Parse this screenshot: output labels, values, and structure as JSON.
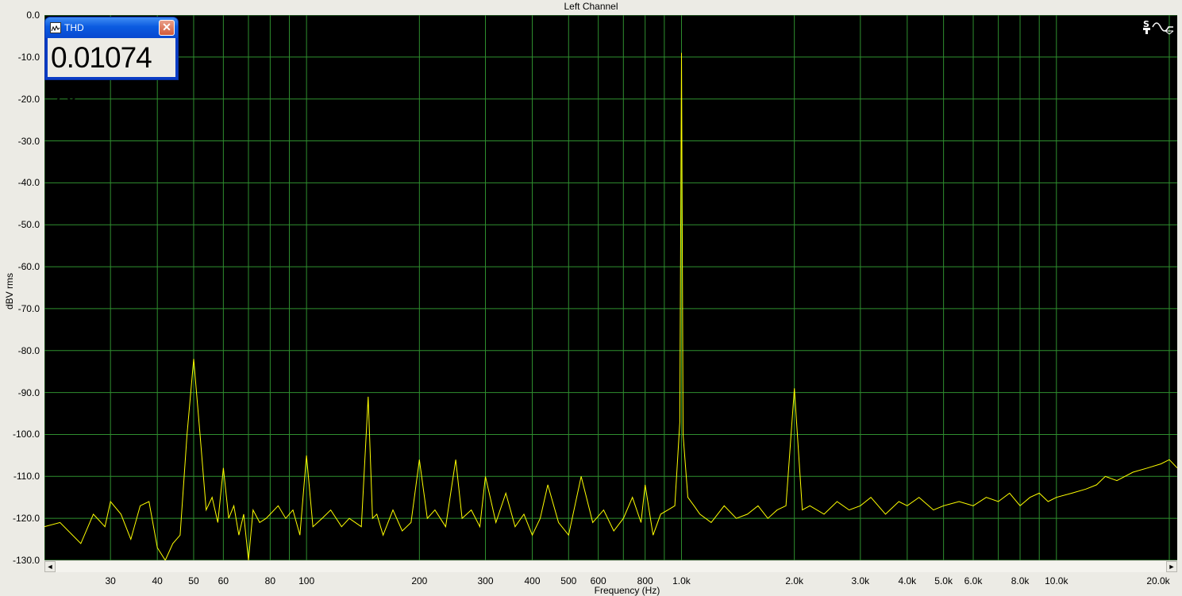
{
  "chart_data": {
    "type": "line",
    "title": "Left Channel",
    "xlabel": "Frequency (Hz)",
    "ylabel": "dBV rms",
    "xscale": "log",
    "xlim": [
      20,
      21000
    ],
    "ylim": [
      -130,
      0
    ],
    "grid": true,
    "yticks": [
      "0.0",
      "-10.0",
      "-20.0",
      "-30.0",
      "-40.0",
      "-50.0",
      "-60.0",
      "-70.0",
      "-80.0",
      "-90.0",
      "-100.0",
      "-110.0",
      "-120.0",
      "-130.0"
    ],
    "ytick_values": [
      0,
      -10,
      -20,
      -30,
      -40,
      -50,
      -60,
      -70,
      -80,
      -90,
      -100,
      -110,
      -120,
      -130
    ],
    "xticks": [
      "30",
      "40",
      "50",
      "60",
      "80",
      "100",
      "200",
      "300",
      "400",
      "500",
      "600",
      "800",
      "1.0k",
      "2.0k",
      "3.0k",
      "4.0k",
      "5.0k",
      "6.0k",
      "8.0k",
      "10.0k",
      "20.0k"
    ],
    "xtick_values": [
      30,
      40,
      50,
      60,
      80,
      100,
      200,
      300,
      400,
      500,
      600,
      800,
      1000,
      2000,
      3000,
      4000,
      5000,
      6000,
      8000,
      10000,
      20000
    ],
    "series": [
      {
        "color": "#ffff00",
        "x": [
          20,
          22,
          25,
          27,
          29,
          30,
          32,
          34,
          36,
          38,
          40,
          42,
          44,
          46,
          48,
          50,
          52,
          54,
          56,
          58,
          60,
          62,
          64,
          66,
          68,
          70,
          72,
          75,
          78,
          80,
          84,
          88,
          92,
          96,
          100,
          104,
          110,
          116,
          124,
          130,
          140,
          146,
          150,
          154,
          160,
          170,
          180,
          190,
          200,
          210,
          220,
          235,
          250,
          260,
          275,
          290,
          300,
          320,
          340,
          360,
          380,
          400,
          420,
          440,
          470,
          500,
          540,
          580,
          620,
          660,
          700,
          740,
          780,
          800,
          840,
          880,
          920,
          960,
          990,
          1000,
          1010,
          1040,
          1080,
          1120,
          1200,
          1300,
          1400,
          1500,
          1600,
          1700,
          1800,
          1900,
          2000,
          2100,
          2200,
          2400,
          2600,
          2800,
          3000,
          3200,
          3500,
          3800,
          4000,
          4300,
          4700,
          5000,
          5500,
          6000,
          6500,
          7000,
          7500,
          8000,
          8500,
          9000,
          9500,
          10000,
          11000,
          12000,
          12800,
          13500,
          14500,
          16000,
          17500,
          19000,
          20000,
          21000
        ],
        "y": [
          -122,
          -121,
          -126,
          -119,
          -122,
          -116,
          -119,
          -125,
          -117,
          -116,
          -127,
          -130,
          -126,
          -124,
          -100,
          -82,
          -100,
          -118,
          -115,
          -121,
          -108,
          -120,
          -117,
          -124,
          -119,
          -130,
          -118,
          -121,
          -120,
          -119,
          -117,
          -120,
          -118,
          -124,
          -105,
          -122,
          -120,
          -118,
          -122,
          -120,
          -122,
          -91,
          -120,
          -119,
          -124,
          -118,
          -123,
          -121,
          -106,
          -120,
          -118,
          -122,
          -106,
          -120,
          -118,
          -122,
          -110,
          -121,
          -114,
          -122,
          -119,
          -124,
          -120,
          -112,
          -121,
          -124,
          -110,
          -121,
          -118,
          -123,
          -120,
          -115,
          -121,
          -112,
          -124,
          -119,
          -118,
          -117,
          -97,
          -9,
          -100,
          -115,
          -117,
          -119,
          -121,
          -117,
          -120,
          -119,
          -117,
          -120,
          -118,
          -117,
          -89,
          -118,
          -117,
          -119,
          -116,
          -118,
          -117,
          -115,
          -119,
          -116,
          -117,
          -115,
          -118,
          -117,
          -116,
          -117,
          -115,
          -116,
          -114,
          -117,
          -115,
          -114,
          -116,
          -115,
          -114,
          -113,
          -112,
          -110,
          -111,
          -109,
          -108,
          -107,
          -106,
          -108
        ]
      }
    ]
  },
  "thd_window": {
    "title": "THD",
    "value": "0.01074 %"
  },
  "scrollbar": {
    "left_arrow": "◄",
    "right_arrow": "►"
  },
  "colors": {
    "plot_background": "#000000",
    "grid": "#2f8f2f",
    "trace": "#ffff00"
  }
}
